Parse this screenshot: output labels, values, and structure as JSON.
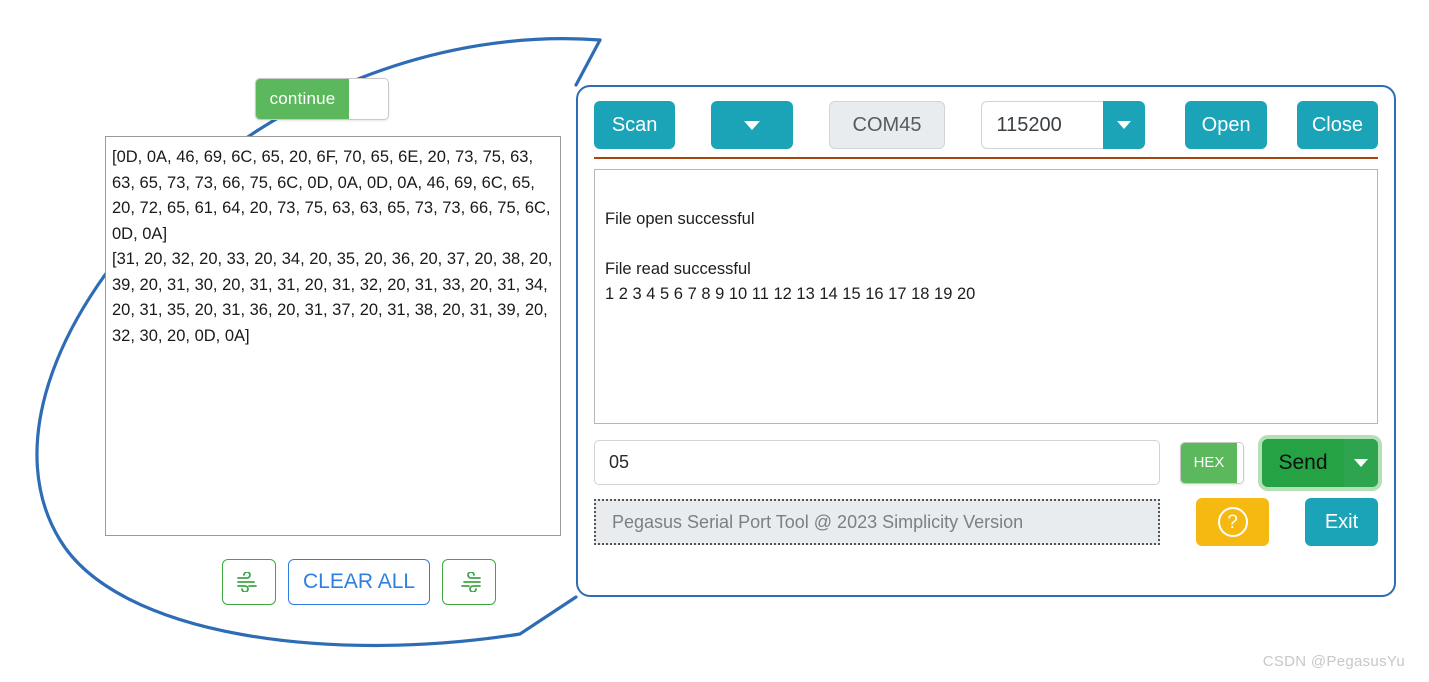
{
  "callout": {
    "circle_color": "#2e6cb5",
    "panel_border_color": "#2e6cb5"
  },
  "magnifier": {
    "continue_toggle": {
      "label": "continue",
      "state": "on",
      "on_color": "#5cb85c"
    },
    "receive_dump": "[0D, 0A, 46, 69, 6C, 65, 20, 6F, 70, 65, 6E, 20, 73, 75, 63, 63, 65, 73, 73, 66, 75, 6C, 0D, 0A, 0D, 0A, 46, 69, 6C, 65, 20, 72, 65, 61, 64, 20, 73, 75, 63, 63, 65, 73, 73, 66, 75, 6C, 0D, 0A]\n[31, 20, 32, 20, 33, 20, 34, 20, 35, 20, 36, 20, 37, 20, 38, 20, 39, 20, 31, 30, 20, 31, 31, 20, 31, 32, 20, 31, 33, 20, 31, 34, 20, 31, 35, 20, 31, 36, 20, 31, 37, 20, 31, 38, 20, 31, 39, 20, 32, 30, 20, 0D, 0A]",
    "buttons": {
      "save_left_icon": "wind-icon",
      "clear_all_label": "CLEAR ALL",
      "save_right_icon": "wind-flipped-icon",
      "clear_all_color": "#2f7fe0",
      "icon_color": "#3fa843"
    }
  },
  "app": {
    "toolbar": {
      "scan_label": "Scan",
      "scan_dropdown_icon": "chevron-down-icon",
      "com_port_value": "COM45",
      "baud_rate_value": "115200",
      "baud_dropdown_icon": "chevron-down-icon",
      "open_label": "Open",
      "close_label": "Close",
      "accent_color": "#1ba3b8",
      "divider_color": "#a8450e"
    },
    "receive": {
      "text": "\nFile open successful\n\nFile read successful\n1 2 3 4 5 6 7 8 9 10 11 12 13 14 15 16 17 18 19 20"
    },
    "send": {
      "input_value": "05",
      "hex_toggle_label": "HEX",
      "hex_toggle_state": "on",
      "send_label": "Send",
      "send_dropdown_icon": "chevron-down-icon",
      "send_color": "#25a244"
    },
    "status": {
      "text": "Pegasus Serial Port Tool @ 2023 Simplicity Version",
      "help_icon": "question-mark-icon",
      "help_color": "#f5b912",
      "exit_label": "Exit"
    }
  },
  "watermark": {
    "text": "CSDN @PegasusYu"
  }
}
